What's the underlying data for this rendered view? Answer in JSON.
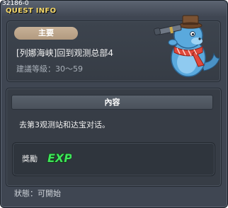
{
  "header": {
    "quest_id": "32186-0",
    "title": "QUEST INFO"
  },
  "quest": {
    "category_badge": "主要",
    "name": "[列娜海峡]回到观测总部4",
    "recommended_level": "建議等級：30～59"
  },
  "content": {
    "section_title": "內容",
    "description": "去第3观测站和达宝对话。"
  },
  "reward": {
    "label": "獎勵",
    "items": [
      {
        "icon": "exp-icon",
        "text": "EXP"
      }
    ]
  },
  "status": {
    "text": "狀態：可開始"
  },
  "colors": {
    "title": "#f5d86a",
    "badge": "#c2aa8e",
    "window": "#3f4652",
    "exp_fill": "#3fe45a"
  },
  "icons": {
    "npc": "telescope-seal-npc-icon"
  }
}
